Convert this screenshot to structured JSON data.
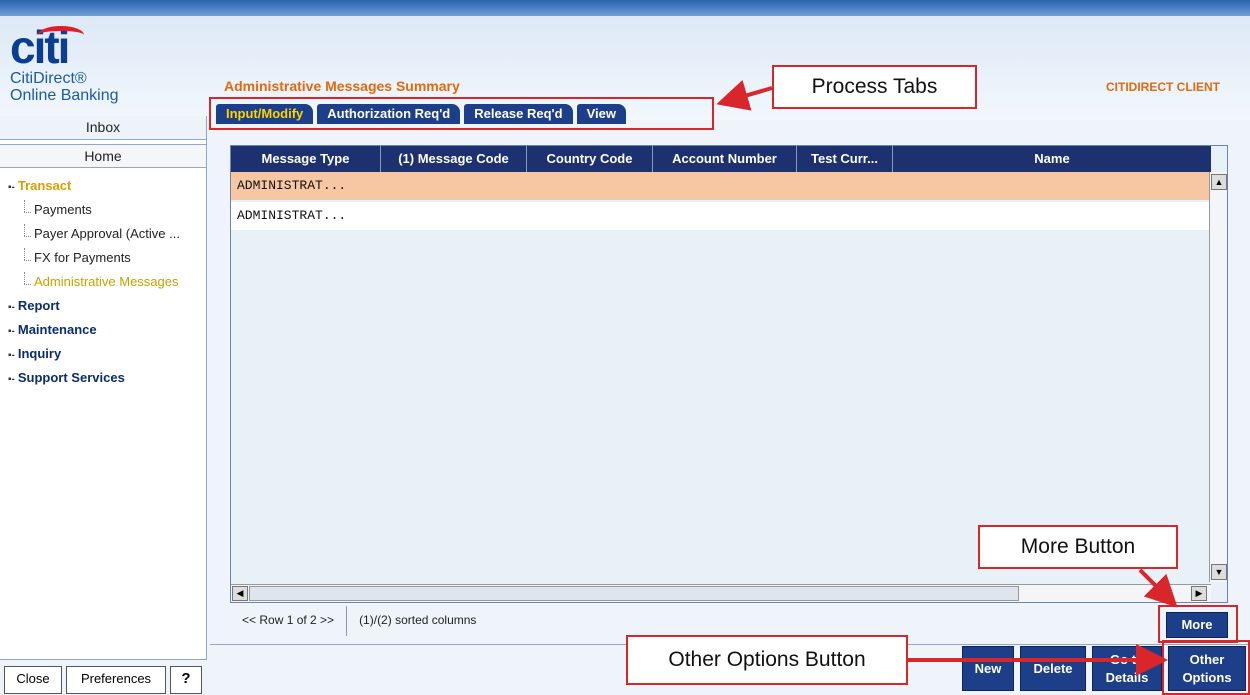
{
  "brand": {
    "logo_text": "citi",
    "product_line1": "CitiDirect®",
    "product_line2": "Online Banking"
  },
  "nav": {
    "inbox": "Inbox",
    "home": "Home",
    "sections": [
      {
        "label": "Transact",
        "active": true,
        "items": [
          {
            "label": "Payments"
          },
          {
            "label": "Payer Approval (Active ..."
          },
          {
            "label": "FX for Payments"
          },
          {
            "label": "Administrative Messages",
            "active": true
          }
        ]
      },
      {
        "label": "Report"
      },
      {
        "label": "Maintenance"
      },
      {
        "label": "Inquiry"
      },
      {
        "label": "Support Services"
      }
    ],
    "bottom": {
      "close": "Close",
      "preferences": "Preferences",
      "help": "?"
    }
  },
  "header": {
    "page_title": "Administrative Messages Summary",
    "client_label": "CITIDIRECT CLIENT"
  },
  "tabs": [
    {
      "label": "Input/Modify",
      "active": true
    },
    {
      "label": "Authorization Req'd"
    },
    {
      "label": "Release Req'd"
    },
    {
      "label": "View"
    }
  ],
  "grid": {
    "columns": [
      "Message Type",
      "(1) Message Code",
      "Country Code",
      "Account Number",
      "Test Curr...",
      "Name"
    ],
    "rows": [
      {
        "message_type": "ADMINISTRAT...",
        "selected": true
      },
      {
        "message_type": "ADMINISTRAT..."
      }
    ]
  },
  "status": {
    "row_info": "<< Row 1 of 2 >>",
    "sort_info": "(1)/(2) sorted columns"
  },
  "buttons": {
    "more": "More",
    "new": "New",
    "delete": "Delete",
    "goto_l1": "Go to",
    "goto_l2": "Details",
    "other_l1": "Other",
    "other_l2": "Options"
  },
  "annotations": {
    "process_tabs": "Process Tabs",
    "more_button": "More Button",
    "other_options_button": "Other Options Button"
  },
  "colors": {
    "accent_orange": "#e06a10",
    "nav_blue": "#1d3e88",
    "selected_row": "#f7c7a3",
    "callout_red": "#d9262b"
  }
}
